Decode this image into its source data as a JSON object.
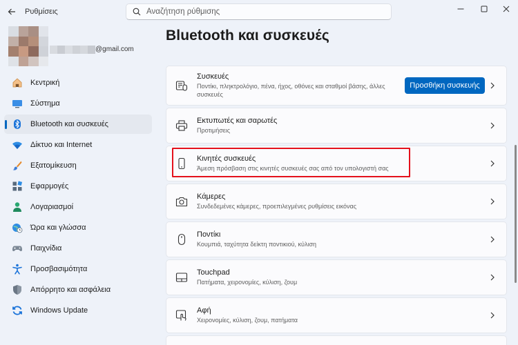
{
  "window": {
    "title": "Ρυθμίσεις",
    "search_placeholder": "Αναζήτηση ρύθμισης"
  },
  "account": {
    "email_suffix": "@gmail.com"
  },
  "sidebar": {
    "items": [
      {
        "label": "Κεντρική",
        "icon": "home-icon"
      },
      {
        "label": "Σύστημα",
        "icon": "monitor-icon"
      },
      {
        "label": "Bluetooth και συσκευές",
        "icon": "bluetooth-icon",
        "active": true
      },
      {
        "label": "Δίκτυο και Internet",
        "icon": "wifi-icon"
      },
      {
        "label": "Εξατομίκευση",
        "icon": "brush-icon"
      },
      {
        "label": "Εφαρμογές",
        "icon": "apps-icon"
      },
      {
        "label": "Λογαριασμοί",
        "icon": "person-icon"
      },
      {
        "label": "Ώρα και γλώσσα",
        "icon": "globe-clock-icon"
      },
      {
        "label": "Παιχνίδια",
        "icon": "gamepad-icon"
      },
      {
        "label": "Προσβασιμότητα",
        "icon": "accessibility-icon"
      },
      {
        "label": "Απόρρητο και ασφάλεια",
        "icon": "shield-icon"
      },
      {
        "label": "Windows Update",
        "icon": "update-icon"
      }
    ]
  },
  "main": {
    "title": "Bluetooth και συσκευές",
    "cards": [
      {
        "title": "Συσκευές",
        "desc": "Ποντίκι, πληκτρολόγιο, πένα, ήχος, οθόνες και σταθμοί βάσης, άλλες συσκευές",
        "icon": "devices-icon",
        "button": "Προσθήκη συσκευής"
      },
      {
        "title": "Εκτυπωτές και σαρωτές",
        "desc": "Προτιμήσεις",
        "icon": "printer-icon"
      },
      {
        "title": "Κινητές συσκευές",
        "desc": "Άμεση πρόσβαση στις κινητές συσκευές σας από τον υπολογιστή σας",
        "icon": "phone-icon"
      },
      {
        "title": "Κάμερες",
        "desc": "Συνδεδεμένες κάμερες, προεπιλεγμένες ρυθμίσεις εικόνας",
        "icon": "camera-icon"
      },
      {
        "title": "Ποντίκι",
        "desc": "Κουμπιά, ταχύτητα δείκτη ποντικιού, κύλιση",
        "icon": "mouse-icon"
      },
      {
        "title": "Touchpad",
        "desc": "Πατήματα, χειρονομίες, κύλιση, ζουμ",
        "icon": "touchpad-icon"
      },
      {
        "title": "Αφή",
        "desc": "Χειρονομίες, κύλιση, ζουμ, πατήματα",
        "icon": "touch-icon"
      }
    ]
  },
  "colors": {
    "accent": "#0067c0",
    "highlight": "#e4101b",
    "background": "#eef2f9",
    "card": "#fbfbfd"
  }
}
